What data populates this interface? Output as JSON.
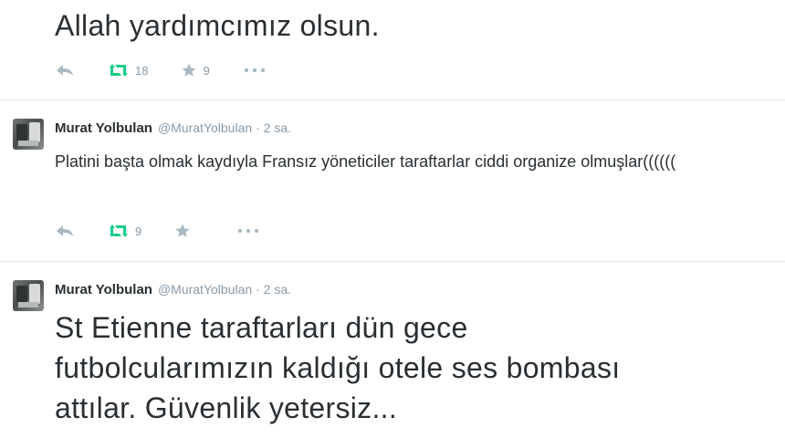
{
  "tweets": [
    {
      "text": "Allah yardımcımız olsun.",
      "retweets": "18",
      "favorites": "9"
    },
    {
      "name": "Murat Yolbulan",
      "handle": "@MuratYolbulan",
      "time": "· 2 sa.",
      "text": "Platini başta olmak kaydıyla Fransız yöneticiler taraftarlar ciddi organize olmuşlar((((((",
      "retweets": "9"
    },
    {
      "name": "Murat Yolbulan",
      "handle": "@MuratYolbulan",
      "time": "· 2 sa.",
      "text_lines": [
        "St Etienne taraftarları dün gece",
        "futbolcularımızın kaldığı otele ses bombası",
        "attılar. Güvenlik yetersiz..."
      ]
    }
  ],
  "colors": {
    "retweet_green": "#19cf86",
    "icon_gray": "#aab8c2",
    "divider": "#e1e8ed",
    "meta_gray": "#8899a6"
  },
  "icons": [
    "reply-icon",
    "retweet-icon",
    "favorite-icon",
    "more-icon"
  ]
}
